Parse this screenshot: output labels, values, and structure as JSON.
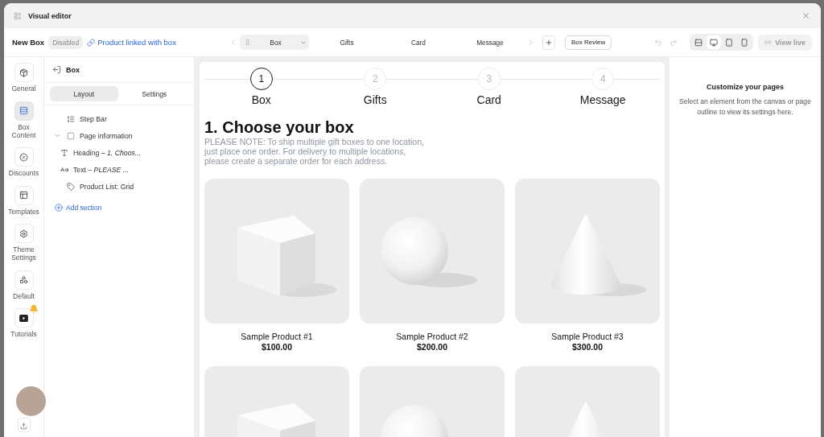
{
  "window": {
    "title": "Visual editor"
  },
  "toolbar": {
    "box_name": "New Box",
    "status": "Disabled",
    "link": "Product linked with box",
    "steps": [
      {
        "label": "Box",
        "selected": true
      },
      {
        "label": "Gifts",
        "selected": false
      },
      {
        "label": "Card",
        "selected": false
      },
      {
        "label": "Message",
        "selected": false
      }
    ],
    "review_button": "Box Review",
    "devices": [
      {
        "kind": "fit",
        "selected": false
      },
      {
        "kind": "desktop",
        "selected": true
      },
      {
        "kind": "tablet",
        "selected": false
      },
      {
        "kind": "mobile",
        "selected": false
      }
    ],
    "view_live": {
      "label": "View live",
      "disabled": true
    }
  },
  "rail": {
    "items": [
      {
        "kind": "general",
        "label": "General",
        "selected": false,
        "notification": false
      },
      {
        "kind": "content",
        "label": "Box Content",
        "selected": true,
        "notification": false
      },
      {
        "kind": "discounts",
        "label": "Discounts",
        "selected": false,
        "notification": false
      },
      {
        "kind": "templates",
        "label": "Templates",
        "selected": false,
        "notification": false
      },
      {
        "kind": "theme",
        "label": "Theme Settings",
        "selected": false,
        "notification": false
      },
      {
        "kind": "default",
        "label": "Default",
        "selected": false,
        "notification": false
      },
      {
        "kind": "tutorials",
        "label": "Tutorials",
        "selected": false,
        "notification": true
      }
    ]
  },
  "panel": {
    "title": "Box",
    "tabs": [
      {
        "label": "Layout",
        "selected": true
      },
      {
        "label": "Settings",
        "selected": false
      }
    ],
    "outline": [
      {
        "kind": "steps",
        "label": "Step Bar"
      },
      {
        "kind": "group",
        "label": "Page information",
        "expanded": true,
        "children": [
          {
            "kind": "heading",
            "label": "Heading – *1. Choos...*"
          },
          {
            "kind": "text",
            "label": "Text – *PLEASE ...*"
          }
        ]
      },
      {
        "kind": "product-list",
        "label": "Product List: Grid"
      }
    ],
    "add_button": "Add section"
  },
  "canvas": {
    "steps": [
      {
        "number": "1",
        "label": "Box",
        "selected": true
      },
      {
        "number": "2",
        "label": "Gifts",
        "selected": false
      },
      {
        "number": "3",
        "label": "Card",
        "selected": false
      },
      {
        "number": "4",
        "label": "Message",
        "selected": false
      }
    ],
    "heading": "1. Choose your box",
    "note": "PLEASE NOTE: To ship multiple gift boxes to one location, just place one order. For delivery to multiple locations, please create a separate order for each address.",
    "products": [
      {
        "kind": "cube",
        "name": "Sample Product #1",
        "price": "$100.00"
      },
      {
        "kind": "sphere",
        "name": "Sample Product #2",
        "price": "$200.00"
      },
      {
        "kind": "cone",
        "name": "Sample Product #3",
        "price": "$300.00"
      },
      {
        "kind": "cube"
      },
      {
        "kind": "sphere"
      },
      {
        "kind": "cone"
      }
    ]
  },
  "inspector": {
    "title": "Customize your pages",
    "description": "Select an element from the canvas or page outline to view its settings here."
  }
}
